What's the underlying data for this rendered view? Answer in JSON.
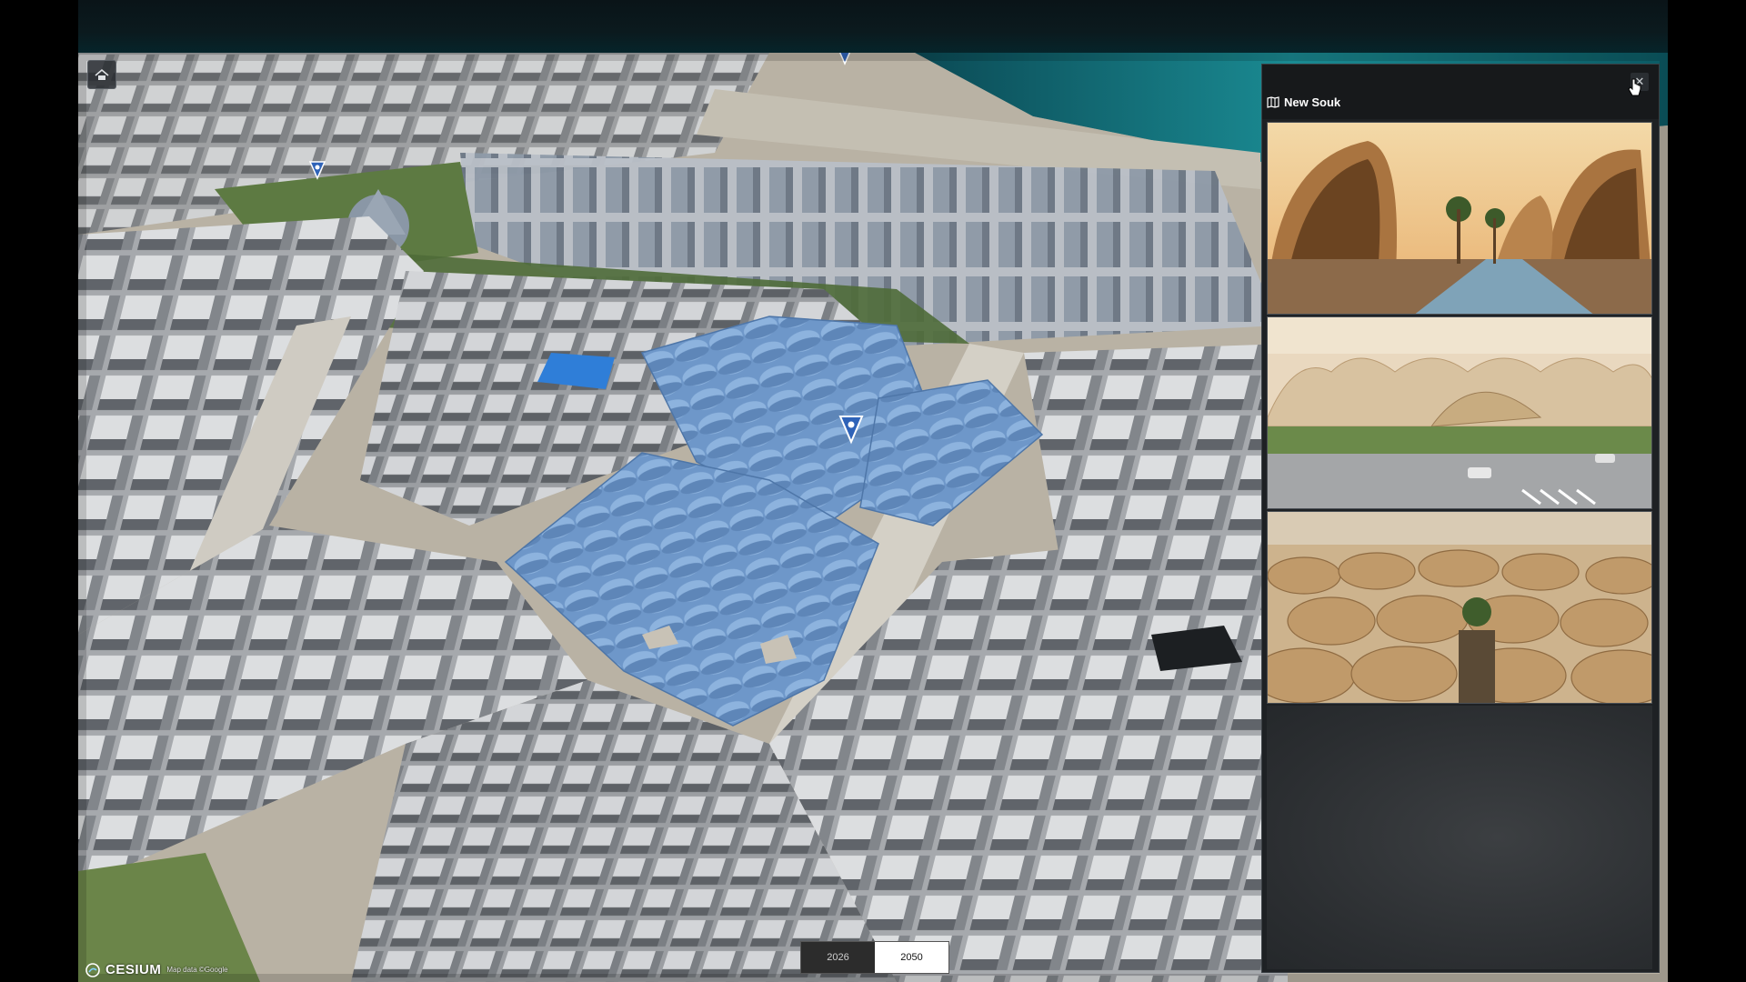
{
  "panel": {
    "title": "New Souk",
    "title_icon": "map-icon",
    "close_icon": "close-icon",
    "images": [
      {
        "name": "souk-render-canopy-street"
      },
      {
        "name": "souk-render-aerial-plaza"
      },
      {
        "name": "souk-render-roofscape"
      }
    ]
  },
  "timeline": {
    "years": [
      "2026",
      "2050"
    ],
    "selected": "2050"
  },
  "credits": {
    "logo": "CESIUM",
    "data": "Map data ©Google"
  },
  "map": {
    "home_icon": "home-icon",
    "marker_icon": "location-pin-icon",
    "highlight_color": "#7ea6d6",
    "building_color": "#c8cacd"
  }
}
